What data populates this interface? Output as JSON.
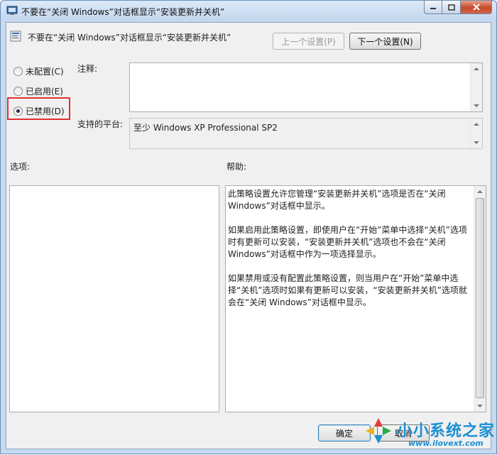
{
  "window": {
    "title": "不要在“关闭 Windows”对话框显示“安装更新并关机”",
    "icons": {
      "app": "policy-icon",
      "minimize": "minimize-icon",
      "maximize": "maximize-icon",
      "close": "close-icon"
    }
  },
  "header": {
    "policy_title": "不要在“关闭 Windows”对话框显示“安装更新并关机”",
    "prev_button": "上一个设置(P)",
    "next_button": "下一个设置(N)"
  },
  "state": {
    "options": [
      {
        "label": "未配置(C)",
        "checked": false
      },
      {
        "label": "已启用(E)",
        "checked": false
      },
      {
        "label": "已禁用(D)",
        "checked": true
      }
    ]
  },
  "comment": {
    "label": "注释:",
    "value": ""
  },
  "platform": {
    "label": "支持的平台:",
    "value": "至少 Windows XP Professional SP2"
  },
  "options_panel": {
    "label": "选项:"
  },
  "help_panel": {
    "label": "帮助:",
    "paragraphs": [
      "此策略设置允许您管理“安装更新并关机”选项是否在“关闭 Windows”对话框中显示。",
      "如果启用此策略设置，即使用户在“开始”菜单中选择“关机”选项时有更新可以安装，“安装更新并关机”选项也不会在“关闭 Windows”对话框中作为一项选择显示。",
      "如果禁用或没有配置此策略设置，则当用户在“开始”菜单中选择“关机”选项时如果有更新可以安装，“安装更新并关机”选项就会在“关闭 Windows”对话框中显示。"
    ]
  },
  "footer": {
    "ok_button": "确定",
    "cancel_button": "取消"
  },
  "watermark": {
    "name": "小小系统之家",
    "url": "www.ilovext.com"
  },
  "colors": {
    "highlight": "#e03030",
    "watermark": "#1a8fd4"
  }
}
